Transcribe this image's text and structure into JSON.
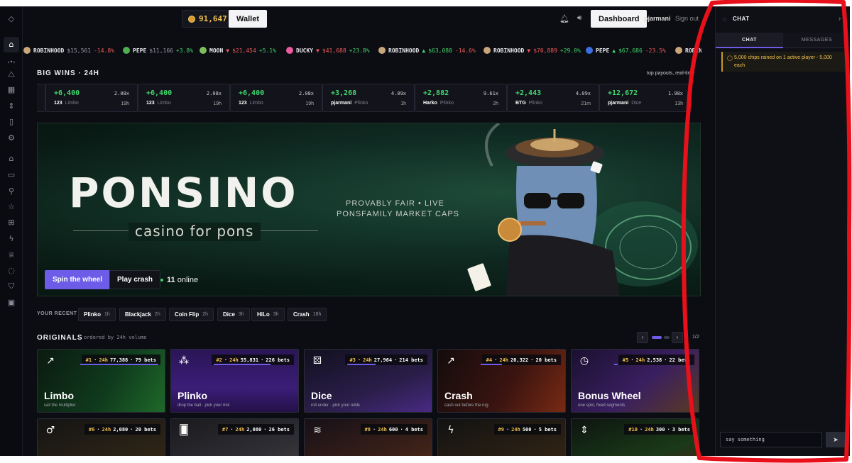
{
  "topbar": {
    "balance": "91,647",
    "wallet_label": "Wallet",
    "dashboard_label": "Dashboard",
    "username": "pjarmani",
    "signout_label": "Sign out"
  },
  "ticker": [
    {
      "name": "ROBINHOOD",
      "price": "$15,561",
      "change": "-14.8%",
      "color": "#c9a57a",
      "dir": "none"
    },
    {
      "name": "PEPE",
      "price": "$11,166",
      "change": "+3.8%",
      "color": "#4caf50",
      "dir": "none"
    },
    {
      "name": "MOON",
      "price": "$21,454",
      "change": "+5.1%",
      "color": "#7bbf5a",
      "dir": "down"
    },
    {
      "name": "DUCKY",
      "price": "$41,688",
      "change": "+23.8%",
      "color": "#e85ca0",
      "dir": "down"
    },
    {
      "name": "ROBINHOOD",
      "price": "$63,088",
      "change": "-14.6%",
      "color": "#c9a57a",
      "dir": "up"
    },
    {
      "name": "ROBINHOOD",
      "price": "$70,889",
      "change": "+29.0%",
      "color": "#c9a57a",
      "dir": "down"
    },
    {
      "name": "PEPE",
      "price": "$67,686",
      "change": "-23.5%",
      "color": "#3b6fe0",
      "dir": "up"
    },
    {
      "name": "ROBINHOOD",
      "price": "",
      "change": "",
      "color": "#c9a57a",
      "dir": "none"
    }
  ],
  "bigwins": {
    "title": "BIG WINS · 24H",
    "note": "top payouts, real-time",
    "items": [
      {
        "amount": "",
        "mult": "",
        "user": "",
        "game": "",
        "ago": ""
      },
      {
        "amount": "+6,400",
        "mult": "2.08x",
        "user": "123",
        "game": "Limbo",
        "ago": "19h"
      },
      {
        "amount": "+6,400",
        "mult": "2.08x",
        "user": "123",
        "game": "Limbo",
        "ago": "19h"
      },
      {
        "amount": "+6,400",
        "mult": "2.08x",
        "user": "123",
        "game": "Limbo",
        "ago": "19h"
      },
      {
        "amount": "+3,268",
        "mult": "4.09x",
        "user": "pjarmani",
        "game": "Plinko",
        "ago": "1h"
      },
      {
        "amount": "+2,882",
        "mult": "9.61x",
        "user": "Harko",
        "game": "Plinko",
        "ago": "2h"
      },
      {
        "amount": "+2,443",
        "mult": "4.09x",
        "user": "BTG",
        "game": "Plinko",
        "ago": "21m"
      },
      {
        "amount": "+12,672",
        "mult": "1.98x",
        "user": "pjarmani",
        "game": "Dice",
        "ago": "13h"
      }
    ]
  },
  "hero": {
    "logo": "PONSINO",
    "tagline": "casino for pons",
    "pitch_line1": "PROVABLY FAIR  •  LIVE",
    "pitch_line2": "PONSFAMILY MARKET CAPS",
    "spin_label": "Spin the wheel",
    "crash_label": "Play crash",
    "online_count": "11",
    "online_label": "online"
  },
  "recent": {
    "label": "YOUR RECENT",
    "items": [
      {
        "game": "Plinko",
        "ago": "1h"
      },
      {
        "game": "Blackjack",
        "ago": "2h"
      },
      {
        "game": "Coin Flip",
        "ago": "2h"
      },
      {
        "game": "Dice",
        "ago": "3h"
      },
      {
        "game": "HiLo",
        "ago": "3h"
      },
      {
        "game": "Crash",
        "ago": "18h"
      }
    ]
  },
  "originals": {
    "title": "ORIGINALS",
    "subtitle": "ordered by 24h volume",
    "page": "1/2",
    "prev_label": "‹",
    "next_label": "›",
    "cards": [
      {
        "rank": "#1",
        "period": "24h",
        "volume": "77,388",
        "bets": "79 bets",
        "name": "Limbo",
        "desc": "call the multiplier",
        "icon": "trend-arrow-icon",
        "glyph": "↗"
      },
      {
        "rank": "#2",
        "period": "24h",
        "volume": "55,831",
        "bets": "226 bets",
        "name": "Plinko",
        "desc": "drop the ball · pick your risk",
        "icon": "plinko-pegs-icon",
        "glyph": "⁂"
      },
      {
        "rank": "#3",
        "period": "24h",
        "volume": "27,964",
        "bets": "214 bets",
        "name": "Dice",
        "desc": "roll under · pick your odds",
        "icon": "dice-icon",
        "glyph": "⚄"
      },
      {
        "rank": "#4",
        "period": "24h",
        "volume": "20,322",
        "bets": "20 bets",
        "name": "Crash",
        "desc": "cash out before the rug",
        "icon": "rising-chart-icon",
        "glyph": "↗"
      },
      {
        "rank": "#5",
        "period": "24h",
        "volume": "2,538",
        "bets": "22 bets",
        "name": "Bonus Wheel",
        "desc": "one spin, fixed segments",
        "icon": "clock-wheel-icon",
        "glyph": "◷"
      },
      {
        "rank": "#6",
        "period": "24h",
        "volume": "2,080",
        "bets": "20 bets",
        "name": "",
        "desc": "",
        "icon": "male-symbol-icon",
        "glyph": "♂"
      },
      {
        "rank": "#7",
        "period": "24h",
        "volume": "2,080",
        "bets": "26 bets",
        "name": "",
        "desc": "",
        "icon": "cards-icon",
        "glyph": "🂠"
      },
      {
        "rank": "#8",
        "period": "24h",
        "volume": "600",
        "bets": "4 bets",
        "name": "",
        "desc": "",
        "icon": "coin-stack-icon",
        "glyph": "≋"
      },
      {
        "rank": "#9",
        "period": "24h",
        "volume": "500",
        "bets": "5 bets",
        "name": "",
        "desc": "",
        "icon": "lightning-coin-icon",
        "glyph": "ϟ"
      },
      {
        "rank": "#10",
        "period": "24h",
        "volume": "300",
        "bets": "3 bets",
        "name": "",
        "desc": "",
        "icon": "up-down-arrows-icon",
        "glyph": "⇕"
      }
    ]
  },
  "chat": {
    "title": "CHAT",
    "tab_chat": "CHAT",
    "tab_messages": "MESSAGES",
    "rain_message": "5,000 chips rained on 1 active player - 5,000 each",
    "input_placeholder": "say something",
    "send_icon": "send-icon"
  },
  "colors": {
    "accent": "#6c5ce7",
    "gain": "#3fd46b",
    "loss": "#f05a5a",
    "gold": "#f2c14e",
    "annotation": "#e8101a"
  }
}
